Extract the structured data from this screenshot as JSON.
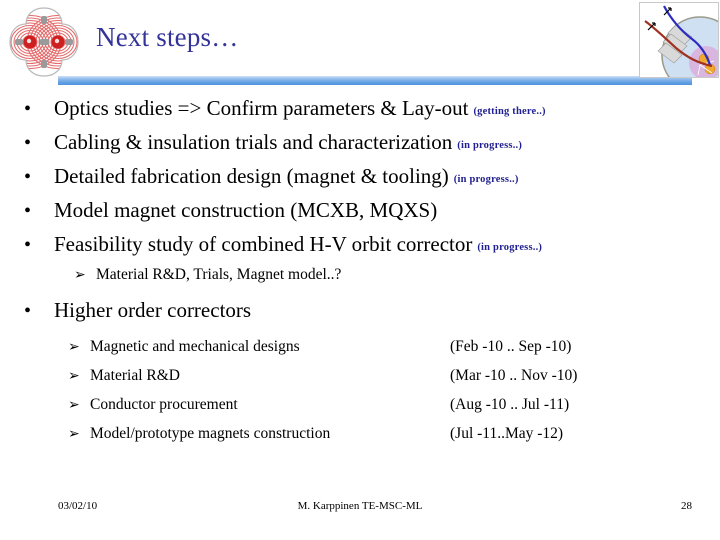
{
  "header": {
    "title": "Next steps…",
    "title_color": "#333399",
    "rule_color": "#6ba5e4",
    "left_logo_icon": "magnetic-field-map-icon",
    "right_image_icon": "beamline-layout-icon"
  },
  "body": {
    "bullets": [
      {
        "marker": "•",
        "text": "Optics studies => Confirm parameters & Lay-out",
        "annotation": "(getting there..)"
      },
      {
        "marker": "•",
        "text": "Cabling & insulation trials and characterization",
        "annotation": "(in progress..)"
      },
      {
        "marker": "•",
        "text": "Detailed fabrication design (magnet & tooling)",
        "annotation": "(in progress..)"
      },
      {
        "marker": "•",
        "text": "Model magnet construction (MCXB, MQXS)",
        "annotation": ""
      },
      {
        "marker": "•",
        "text": "Feasibility study of combined H-V orbit corrector",
        "annotation": "(in progress..)"
      }
    ],
    "sub_bullet": {
      "marker": "➢",
      "text": "Material R&D, Trials, Magnet model..?"
    },
    "higher_order": {
      "marker": "•",
      "text": "Higher order correctors",
      "annotation": ""
    },
    "schedule": {
      "marker": "➢",
      "rows": [
        {
          "task": "Magnetic and mechanical designs",
          "period": "(Feb -10 .. Sep -10)"
        },
        {
          "task": "Material R&D",
          "period": "(Mar -10 .. Nov -10)"
        },
        {
          "task": "Conductor procurement",
          "period": "(Aug -10 .. Jul -11)"
        },
        {
          "task": "Model/prototype magnets construction",
          "period": "(Jul -11..May -12)"
        }
      ]
    }
  },
  "footer": {
    "date": "03/02/10",
    "author": "M. Karppinen TE-MSC-ML",
    "page": "28"
  }
}
